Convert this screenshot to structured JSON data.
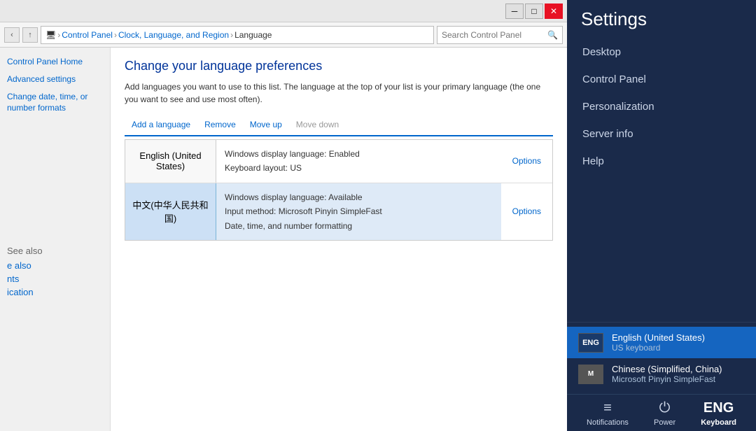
{
  "titlebar": {
    "minimize_label": "─",
    "maximize_label": "□",
    "close_label": "✕"
  },
  "addressbar": {
    "back_btn": "‹",
    "up_btn": "↑",
    "breadcrumb": {
      "icon": "🖥",
      "parts": [
        "Control Panel",
        "Clock, Language, and Region",
        "Language"
      ]
    },
    "search_placeholder": "Search Control Panel",
    "search_icon": "🔍"
  },
  "sidebar": {
    "links": [
      {
        "id": "cp-home",
        "label": "Control Panel Home"
      },
      {
        "id": "advanced-settings",
        "label": "Advanced settings"
      },
      {
        "id": "change-date",
        "label": "Change date, time, or number formats"
      }
    ],
    "see_also_title": "See also",
    "see_also_links": [
      {
        "id": "see-also-1",
        "label": "e also"
      },
      {
        "id": "see-also-2",
        "label": "nts"
      },
      {
        "id": "see-also-3",
        "label": "ication"
      }
    ]
  },
  "content": {
    "title": "Change your language preferences",
    "description": "Add languages you want to use to this list. The language at the top of your list is your primary language (the one you want to see and use most often).",
    "toolbar": {
      "add": "Add a language",
      "remove": "Remove",
      "move_up": "Move up",
      "move_down": "Move down"
    },
    "languages": [
      {
        "name": "English (United States)",
        "detail1": "Windows display language: Enabled",
        "detail2": "Keyboard layout: US",
        "options_label": "Options",
        "selected": false
      },
      {
        "name": "中文(中华人民共和国)",
        "detail1": "Windows display language: Available",
        "detail2": "Input method: Microsoft Pinyin SimpleFast",
        "detail3": "Date, time, and number formatting",
        "options_label": "Options",
        "selected": true
      }
    ]
  },
  "settings": {
    "title": "Settings",
    "menu_items": [
      {
        "id": "desktop",
        "label": "Desktop"
      },
      {
        "id": "control-panel",
        "label": "Control Panel"
      },
      {
        "id": "personalization",
        "label": "Personalization"
      },
      {
        "id": "server-info",
        "label": "Server info"
      },
      {
        "id": "help",
        "label": "Help"
      }
    ],
    "language_options": [
      {
        "id": "eng",
        "flag": "ENG",
        "name": "English (United States)",
        "sub": "US keyboard",
        "selected": true
      },
      {
        "id": "chi",
        "flag": "M",
        "name": "Chinese (Simplified, China)",
        "sub": "Microsoft Pinyin SimpleFast",
        "selected": false
      }
    ],
    "taskbar": {
      "notifications_label": "Notifications",
      "notifications_icon": "≡",
      "power_label": "Power",
      "power_icon": "⏻",
      "keyboard_label": "Keyboard",
      "keyboard_value": "ENG"
    }
  }
}
